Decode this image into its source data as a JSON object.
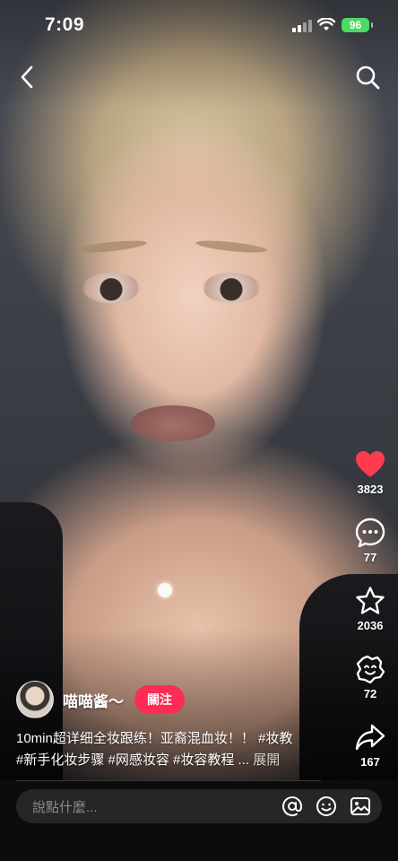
{
  "status_bar": {
    "time": "7:09",
    "battery": "96"
  },
  "video": {
    "description": ""
  },
  "author": {
    "name": "喵喵酱～",
    "follow_label": "關注"
  },
  "caption": {
    "line1": "10min超详细全妆跟练！亚裔混血妆！！ #妆教",
    "line2": "#新手化妆步骤 #网感妆容 #妆容教程 ...",
    "expand_label": "展開"
  },
  "actions": {
    "likes": "3823",
    "comments": "77",
    "favorites": "2036",
    "shares_reaction": "72",
    "shares": "167"
  },
  "comment_bar": {
    "placeholder": "說點什麼..."
  },
  "icons": {
    "back": "chevron-left-icon",
    "search": "search-icon",
    "like": "heart-icon",
    "comment": "comment-icon",
    "favorite": "star-icon",
    "reaction": "sticker-icon",
    "share": "share-icon",
    "mention": "at-icon",
    "emoji": "emoji-icon",
    "image": "image-icon"
  },
  "colors": {
    "like": "#ff3b4f",
    "follow": "#fe2c55",
    "battery": "#4cd964"
  }
}
